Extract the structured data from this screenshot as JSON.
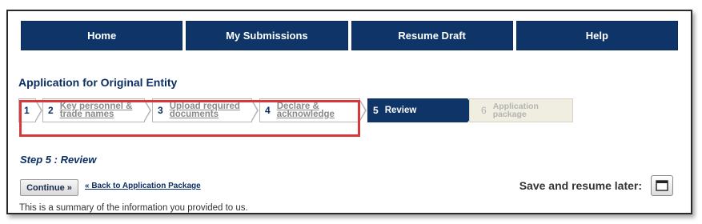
{
  "nav": {
    "items": [
      {
        "label": "Home"
      },
      {
        "label": "My Submissions"
      },
      {
        "label": "Resume Draft"
      },
      {
        "label": "Help"
      }
    ]
  },
  "page_title": "Application for Original Entity",
  "steps": [
    {
      "num": "1",
      "label": ""
    },
    {
      "num": "2",
      "label": "Key personnel & trade names"
    },
    {
      "num": "3",
      "label": "Upload required documents"
    },
    {
      "num": "4",
      "label": "Declare & acknowledge"
    },
    {
      "num": "5",
      "label": "Review"
    },
    {
      "num": "6",
      "label": "Application package"
    }
  ],
  "step_heading": "Step 5 : Review",
  "continue_label": "Continue »",
  "back_link": "« Back to Application Package",
  "save_label": "Save and resume later:",
  "save_icon": "save-resume-icon",
  "summary_text": "This is a summary of the information you provided to us.",
  "colors": {
    "nav": "#0f3568",
    "title": "#0b2e63",
    "highlight": "#d9383b",
    "future": "#f0eee1"
  }
}
